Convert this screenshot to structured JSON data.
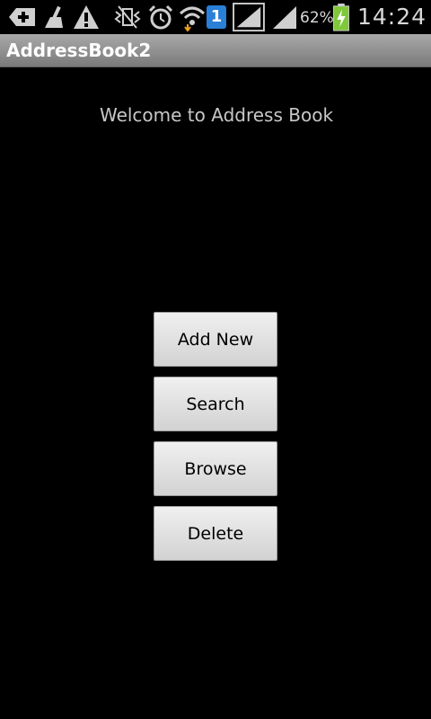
{
  "status_bar": {
    "battery_percent": "62%",
    "time": "14:24",
    "sim_badge": "1",
    "icons": [
      "add-notification-icon",
      "broom-icon",
      "warning-icon",
      "vibrate-off-icon",
      "alarm-icon",
      "wifi-icon",
      "sim-1-icon",
      "signal-icon",
      "signal-icon",
      "battery-charging-icon"
    ]
  },
  "app": {
    "title": "AddressBook2"
  },
  "main": {
    "welcome_text": "Welcome to Address Book",
    "buttons": {
      "add_new": "Add New",
      "search": "Search",
      "browse": "Browse",
      "delete": "Delete"
    }
  },
  "colors": {
    "background": "#000000",
    "title_bar": "#8f8f8f",
    "battery_green": "#7ec83a",
    "sim_blue": "#2a7fd6"
  }
}
